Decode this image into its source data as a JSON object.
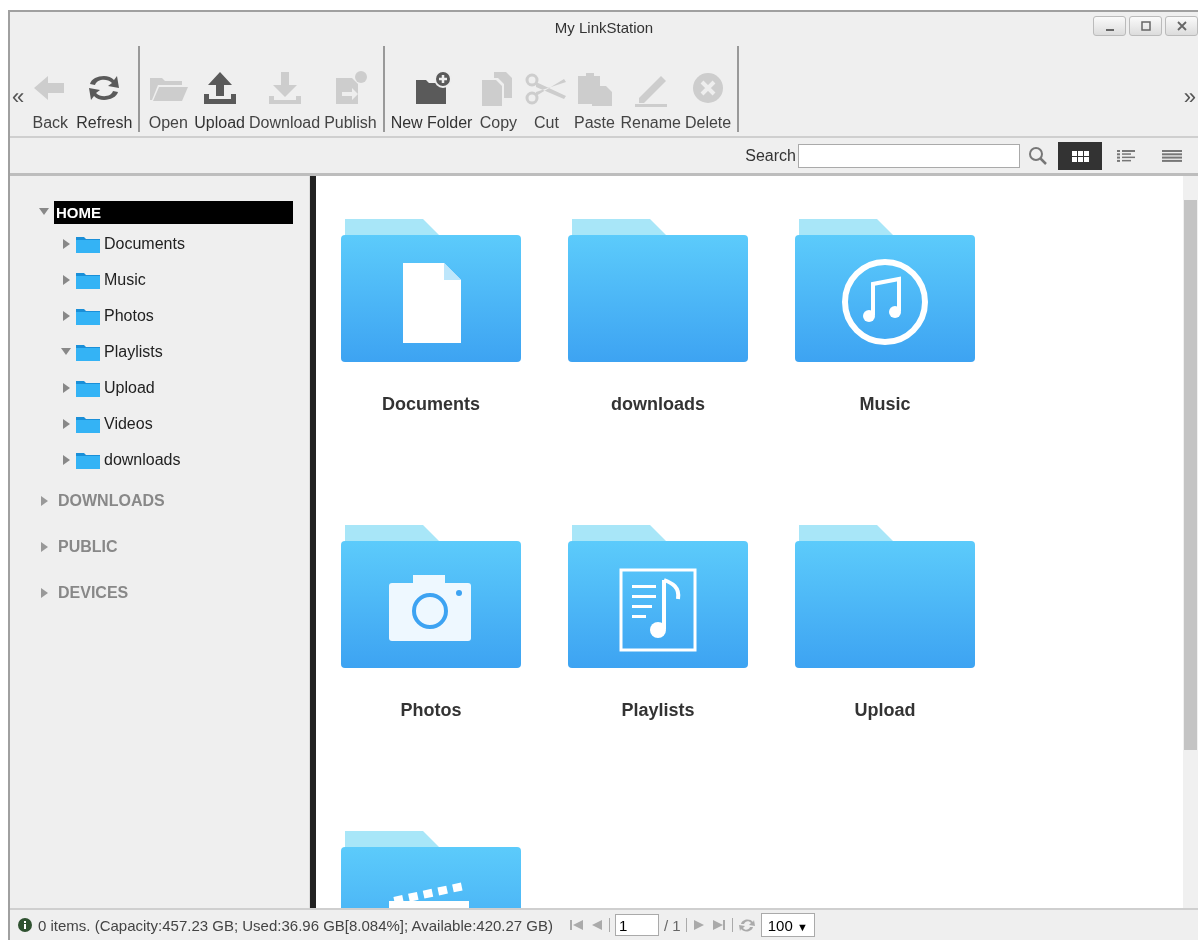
{
  "window": {
    "title": "My LinkStation"
  },
  "toolbar": {
    "scroll_left": "«",
    "scroll_right": "»",
    "groups": [
      [
        {
          "label": "Back",
          "kind": "back",
          "disabled": true
        },
        {
          "label": "Refresh",
          "kind": "refresh",
          "disabled": false
        }
      ],
      [
        {
          "label": "Open",
          "kind": "open",
          "disabled": true
        },
        {
          "label": "Upload",
          "kind": "upload",
          "disabled": false
        },
        {
          "label": "Download",
          "kind": "download",
          "disabled": true
        },
        {
          "label": "Publish",
          "kind": "publish",
          "disabled": true
        }
      ],
      [
        {
          "label": "New Folder",
          "kind": "newfolder",
          "disabled": false
        },
        {
          "label": "Copy",
          "kind": "copy",
          "disabled": true
        },
        {
          "label": "Cut",
          "kind": "cut",
          "disabled": true
        },
        {
          "label": "Paste",
          "kind": "paste",
          "disabled": true
        },
        {
          "label": "Rename",
          "kind": "rename",
          "disabled": true
        },
        {
          "label": "Delete",
          "kind": "delete",
          "disabled": true
        }
      ]
    ]
  },
  "search": {
    "label": "Search"
  },
  "view_modes": [
    {
      "kind": "grid",
      "selected": true
    },
    {
      "kind": "list",
      "selected": false
    },
    {
      "kind": "details",
      "selected": false
    }
  ],
  "sidebar": {
    "tree": {
      "label": "HOME",
      "expanded": true,
      "selected": true,
      "children": [
        {
          "label": "Documents",
          "expanded": false
        },
        {
          "label": "Music",
          "expanded": false
        },
        {
          "label": "Photos",
          "expanded": false
        },
        {
          "label": "Playlists",
          "expanded": true
        },
        {
          "label": "Upload",
          "expanded": false
        },
        {
          "label": "Videos",
          "expanded": false
        },
        {
          "label": "downloads",
          "expanded": false
        }
      ]
    },
    "sections": [
      {
        "label": "DOWNLOADS",
        "expanded": false
      },
      {
        "label": "PUBLIC",
        "expanded": false
      },
      {
        "label": "DEVICES",
        "expanded": false
      }
    ]
  },
  "folders": [
    {
      "name": "Documents",
      "kind": "document"
    },
    {
      "name": "downloads",
      "kind": "plain"
    },
    {
      "name": "Music",
      "kind": "music"
    },
    {
      "name": "Photos",
      "kind": "camera"
    },
    {
      "name": "Playlists",
      "kind": "playlist"
    },
    {
      "name": "Upload",
      "kind": "plain"
    },
    {
      "kind": "video"
    }
  ],
  "status_bar": {
    "text": "0 items. (Capacity:457.23 GB; Used:36.96 GB[8.084%]; Available:420.27 GB)",
    "page": "1",
    "page_total": "/ 1",
    "page_size": "100",
    "dropdown_arrow": "▼"
  }
}
